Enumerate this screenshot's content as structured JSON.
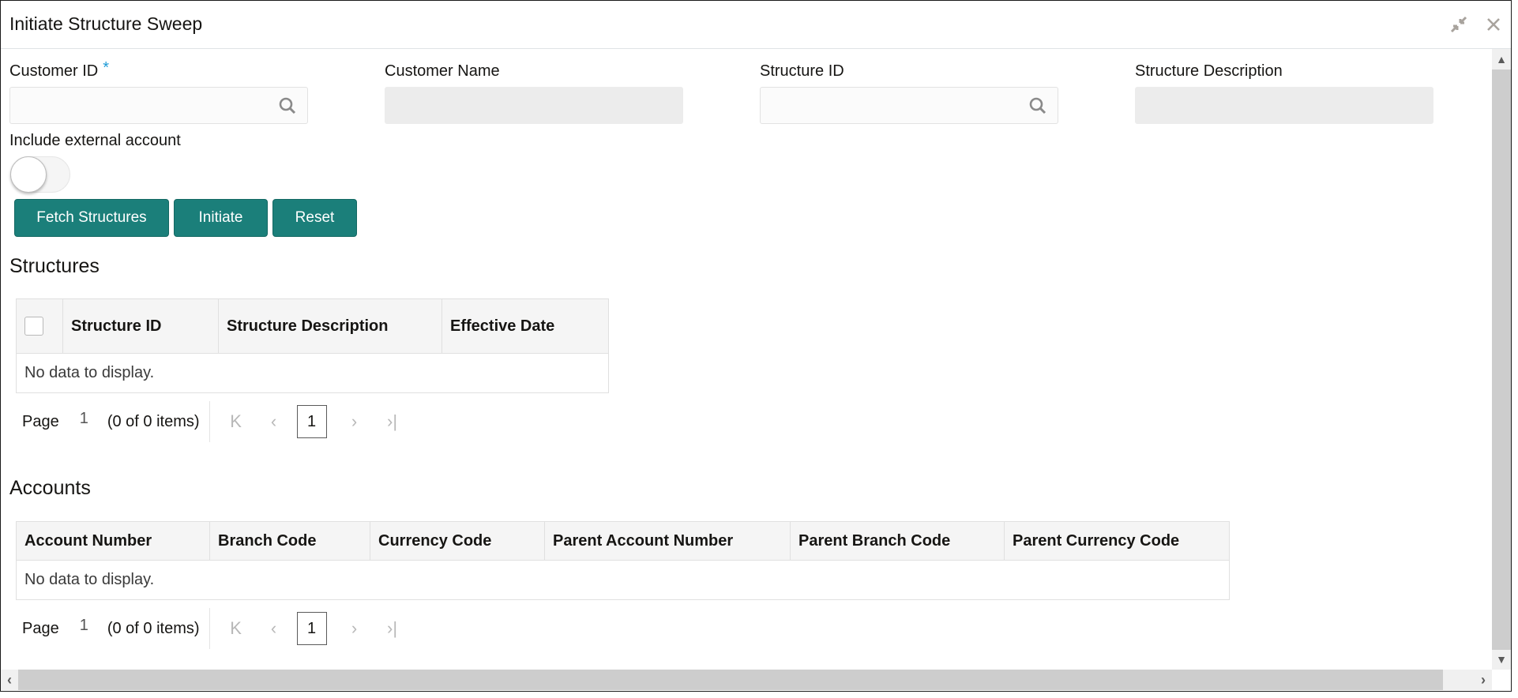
{
  "window": {
    "title": "Initiate Structure Sweep",
    "icons": {
      "minimize": "compress-icon",
      "close": "close-icon"
    }
  },
  "form": {
    "customer_id": {
      "label": "Customer ID",
      "required_mark": "*",
      "value": "",
      "placeholder": ""
    },
    "customer_name": {
      "label": "Customer Name",
      "value": ""
    },
    "structure_id": {
      "label": "Structure ID",
      "value": "",
      "placeholder": ""
    },
    "structure_description": {
      "label": "Structure Description",
      "value": ""
    },
    "include_external": {
      "label": "Include external account",
      "checked": false
    }
  },
  "buttons": {
    "fetch": "Fetch Structures",
    "initiate": "Initiate",
    "reset": "Reset"
  },
  "colors": {
    "primary": "#1b7f7a",
    "required": "#1e9bd7"
  },
  "structures": {
    "title": "Structures",
    "columns": [
      "Structure ID",
      "Structure Description",
      "Effective Date"
    ],
    "empty_text": "No data to display.",
    "pager": {
      "label": "Page",
      "page": "1",
      "count": "(0 of 0 items)",
      "current": "1"
    }
  },
  "accounts": {
    "title": "Accounts",
    "columns": [
      "Account Number",
      "Branch Code",
      "Currency Code",
      "Parent Account Number",
      "Parent Branch Code",
      "Parent Currency Code"
    ],
    "empty_text": "No data to display.",
    "pager": {
      "label": "Page",
      "page": "1",
      "count": "(0 of 0 items)",
      "current": "1"
    }
  },
  "pager_icons": {
    "first": "K",
    "prev": "‹",
    "next": "›",
    "last": "›|"
  }
}
